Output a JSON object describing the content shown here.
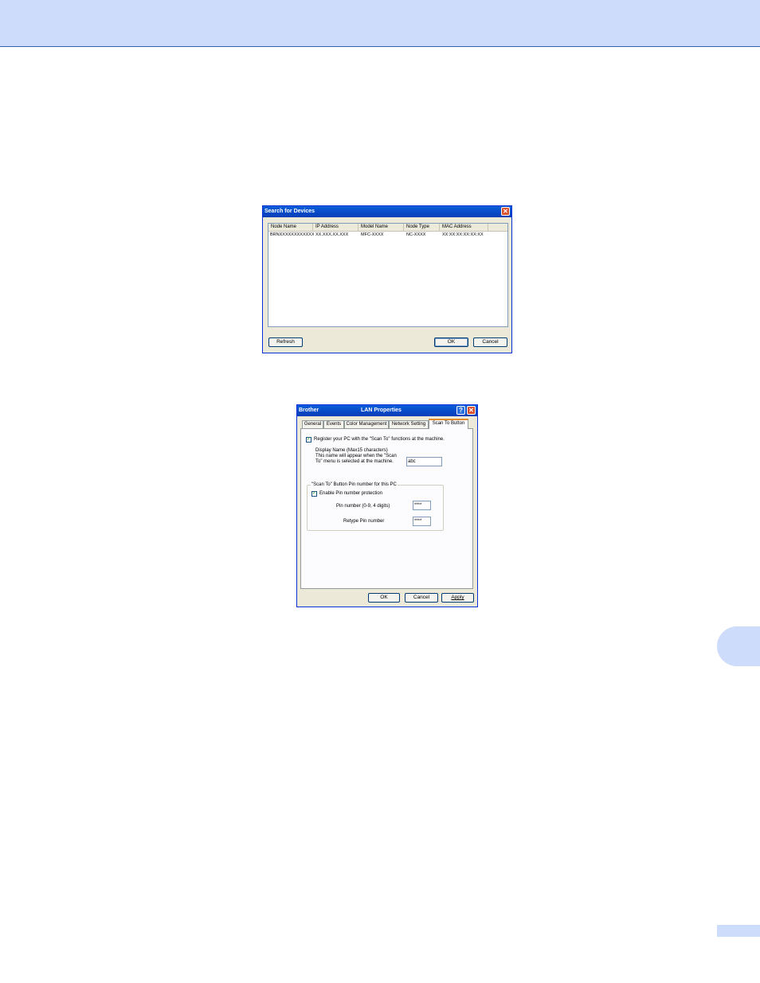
{
  "search_dialog": {
    "title": "Search for Devices",
    "columns": [
      "Node Name",
      "IP Address",
      "Model Name",
      "Node Type",
      "MAC Address"
    ],
    "rows": [
      [
        "BRNXXXXXXXXXXXX",
        "XX.XXX.XX.XXX",
        "MFC-XXXX",
        "NC-XXXX",
        "XX:XX:XX:XX:XX:XX"
      ]
    ],
    "refresh_label": "Refresh",
    "ok_label": "OK",
    "cancel_label": "Cancel"
  },
  "lan_dialog": {
    "title_left": "Brother",
    "title_center": "LAN Properties",
    "tabs": [
      "General",
      "Events",
      "Color Management",
      "Network Setting",
      "Scan To Button"
    ],
    "active_tab": "Scan To Button",
    "register_label": "Register your PC with the \"Scan To\" functions at the machine.",
    "register_checked": true,
    "display_name_label_1": "Display Name (Max15 characters)",
    "display_name_label_2": "This name will appear when the \"Scan",
    "display_name_label_3": "To\" menu is selected at the machine.",
    "display_name_value": "abc",
    "group_title": "\"Scan To\" Button Pin number for this PC",
    "enable_pin_label": "Enable Pin number protection",
    "enable_pin_checked": true,
    "pin_label": "Pin number (0-9, 4 digits)",
    "pin_value": "****",
    "retype_label": "Retype Pin number",
    "retype_value": "****",
    "ok_label": "OK",
    "cancel_label": "Cancel",
    "apply_label": "Apply"
  }
}
